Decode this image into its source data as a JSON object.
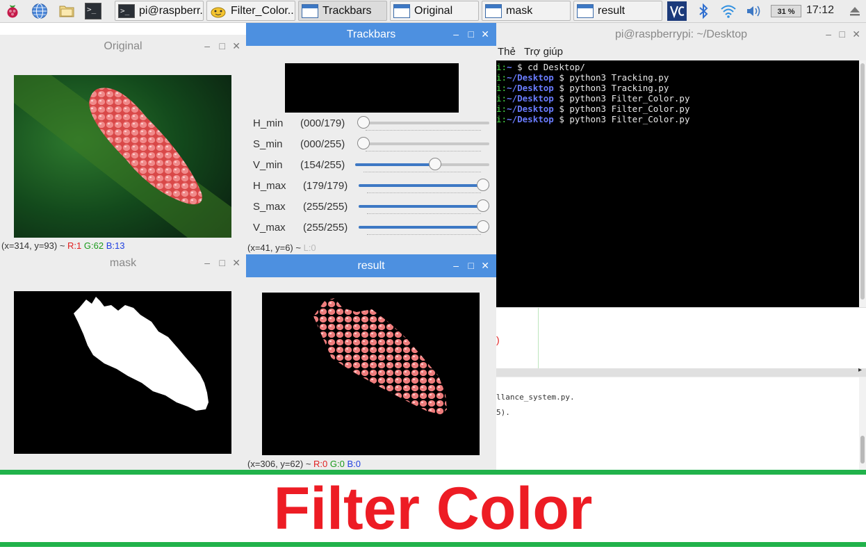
{
  "taskbar": {
    "buttons": [
      {
        "label": "pi@raspberr..."
      },
      {
        "label": "Filter_Color...."
      },
      {
        "label": "Trackbars"
      },
      {
        "label": "Original"
      },
      {
        "label": "mask"
      },
      {
        "label": "result"
      }
    ],
    "cpu": "31 %",
    "clock": "17:12",
    "icons": [
      "raspberry-menu-icon",
      "web-browser-icon",
      "file-manager-icon",
      "terminal-icon",
      "vnc-icon",
      "bluetooth-icon",
      "wifi-icon",
      "volume-icon",
      "eject-icon"
    ]
  },
  "original": {
    "title": "Original",
    "status": {
      "coords": "(x=314, y=93) ~",
      "r": "R:1",
      "g": "G:62",
      "b": "B:13"
    }
  },
  "trackbars": {
    "title": "Trackbars",
    "status": {
      "coords": "(x=41, y=6) ~",
      "l": "L:0"
    },
    "bars": [
      {
        "name": "H_min",
        "value": "(000/179)",
        "fraction": 0.0
      },
      {
        "name": "S_min",
        "value": "(000/255)",
        "fraction": 0.0
      },
      {
        "name": "V_min",
        "value": "(154/255)",
        "fraction": 0.604
      },
      {
        "name": "H_max",
        "value": "(179/179)",
        "fraction": 1.0
      },
      {
        "name": "S_max",
        "value": "(255/255)",
        "fraction": 1.0
      },
      {
        "name": "V_max",
        "value": "(255/255)",
        "fraction": 1.0
      }
    ]
  },
  "mask": {
    "title": "mask"
  },
  "result": {
    "title": "result",
    "status": {
      "coords": "(x=306, y=62) ~",
      "r": "R:0",
      "g": "G:0",
      "b": "B:0"
    }
  },
  "terminal": {
    "title": "pi@raspberrypi: ~/Desktop",
    "menu": [
      "Thẻ",
      "Trợ giúp"
    ],
    "lines": [
      {
        "prefix": "i:",
        "path": "~",
        "cmd": " $ cd Desktop/"
      },
      {
        "prefix": "i:",
        "path": "~/Desktop",
        "cmd": " $ python3 Tracking.py"
      },
      {
        "prefix": "i:",
        "path": "~/Desktop",
        "cmd": " $ python3 Tracking.py"
      },
      {
        "prefix": "i:",
        "path": "~/Desktop",
        "cmd": " $ python3 Filter_Color.py"
      },
      {
        "prefix": "i:",
        "path": "~/Desktop",
        "cmd": " $ python3 Filter_Color.py"
      },
      {
        "prefix": "i:",
        "path": "~/Desktop",
        "cmd": " $ python3 Filter_Color.py"
      }
    ]
  },
  "editor": {
    "bracket": ")",
    "shell_lines": [
      "llance_system.py.",
      "5)."
    ]
  },
  "banner": {
    "text": "Filter Color"
  },
  "colors": {
    "accent": "#4d90e0",
    "banner_green": "#21b24b",
    "banner_red": "#ed1c24"
  }
}
